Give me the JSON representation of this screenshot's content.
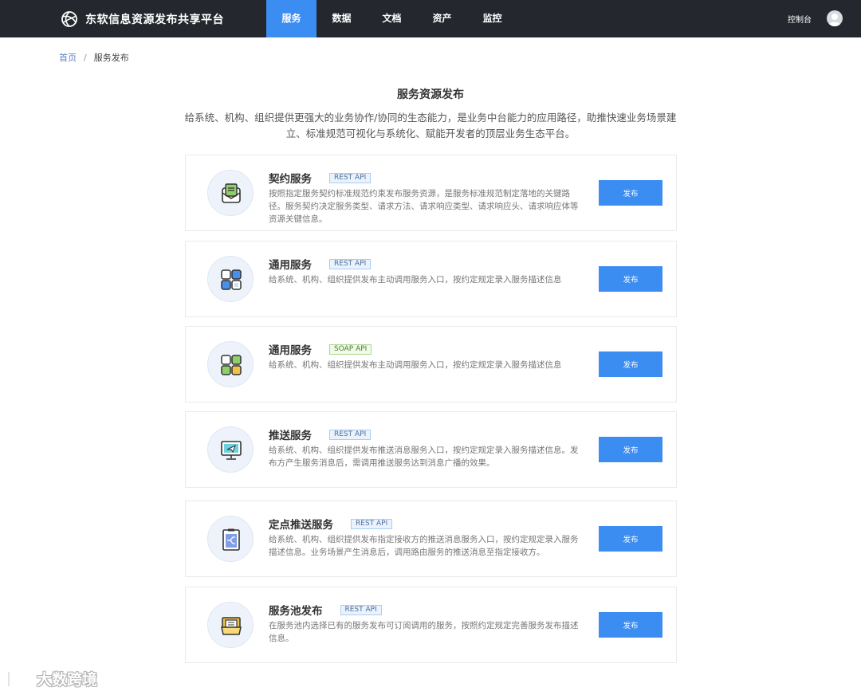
{
  "header": {
    "brand": "东软信息资源发布共享平台",
    "nav": [
      {
        "label": "服务",
        "active": true
      },
      {
        "label": "数据",
        "active": false
      },
      {
        "label": "文档",
        "active": false
      },
      {
        "label": "资产",
        "active": false
      },
      {
        "label": "监控",
        "active": false
      }
    ],
    "console": "控制台"
  },
  "breadcrumb": {
    "home": "首页",
    "separator": "/",
    "current": "服务发布"
  },
  "page": {
    "title": "服务资源发布",
    "description": "给系统、机构、组织提供更强大的业务协作/协同的生态能力，是业务中台能力的应用路径，助推快速业务场景建立、标准规范可视化与系统化、赋能开发者的顶层业务生态平台。"
  },
  "services": [
    {
      "title": "契约服务",
      "tag": "REST API",
      "desc": "按照指定服务契约标准规范约束发布服务资源，是服务标准规范制定落地的关键路径。服务契约决定服务类型、请求方法、请求响应类型、请求响应头、请求响应体等资源关键信息。",
      "button": "发布",
      "icon": "contract-icon"
    },
    {
      "title": "通用服务",
      "tag": "REST API",
      "desc": "给系统、机构、组织提供发布主动调用服务入口，按约定规定录入服务描述信息",
      "button": "发布",
      "icon": "grid-blue-icon"
    },
    {
      "title": "通用服务",
      "tag": "SOAP API",
      "desc": "给系统、机构、组织提供发布主动调用服务入口，按约定规定录入服务描述信息",
      "button": "发布",
      "icon": "grid-green-icon"
    },
    {
      "title": "推送服务",
      "tag": "REST API",
      "desc": "给系统、机构、组织提供发布推送消息服务入口，按约定规定录入服务描述信息。发布方产生服务消息后，需调用推送服务达到消息广播的效果。",
      "button": "发布",
      "icon": "monitor-send-icon"
    },
    {
      "title": "定点推送服务",
      "tag": "REST API",
      "desc": "给系统、机构、组织提供发布指定接收方的推送消息服务入口，按约定规定录入服务描述信息。业务场景产生消息后，调用路由服务的推送消息至指定接收方。",
      "button": "发布",
      "icon": "clipboard-route-icon"
    },
    {
      "title": "服务池发布",
      "tag": "REST API",
      "desc": "在服务池内选择已有的服务发布可订阅调用的服务，按照约定规定完善服务发布描述信息。",
      "button": "发布",
      "icon": "folder-pool-icon"
    }
  ],
  "watermark": "大数跨境",
  "colors": {
    "topbar": "#24272e",
    "accent": "#3b8df2",
    "tag_rest": "#eaf3fd",
    "tag_soap": "#f1fae9"
  }
}
